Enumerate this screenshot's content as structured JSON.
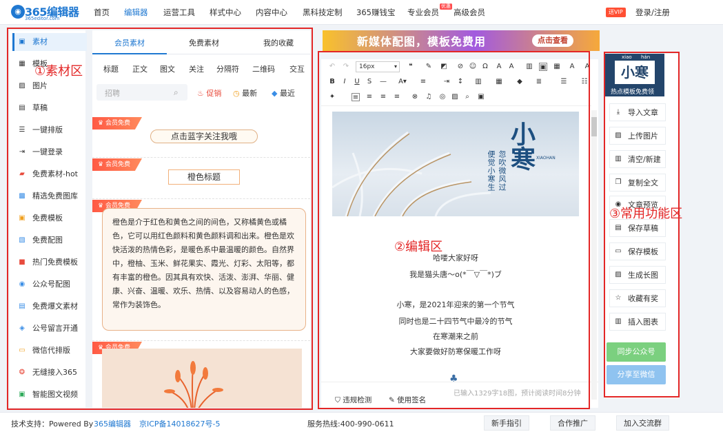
{
  "nav": {
    "logo_text": "365编辑器",
    "logo_sub": "365editor.com",
    "items": [
      "首页",
      "编辑器",
      "运营工具",
      "样式中心",
      "内容中心",
      "黑科技定制",
      "365赚钱宝",
      "专业会员",
      "高级会员"
    ],
    "new_badge": "优惠",
    "vip_badge": "送VIP",
    "login": "登录/注册"
  },
  "left_nav": {
    "items": [
      {
        "label": "素材",
        "icon": "material-icon"
      },
      {
        "label": "模板",
        "icon": "template-icon"
      },
      {
        "label": "图片",
        "icon": "image-icon"
      },
      {
        "label": "草稿",
        "icon": "draft-icon"
      },
      {
        "label": "一键排版",
        "icon": "list-icon"
      },
      {
        "label": "一键登录",
        "icon": "login-icon"
      },
      {
        "label": "免费素材-hot",
        "icon": "free-material-icon"
      },
      {
        "label": "精选免费图库",
        "icon": "gallery-icon"
      },
      {
        "label": "免费模板",
        "icon": "free-template-icon"
      },
      {
        "label": "免费配图",
        "icon": "free-image-icon"
      },
      {
        "label": "热门免费模板",
        "icon": "hot-template-icon"
      },
      {
        "label": "公众号配图",
        "icon": "wechat-image-icon"
      },
      {
        "label": "免费爆文素材",
        "icon": "article-icon"
      },
      {
        "label": "公号留言开通",
        "icon": "comment-icon"
      },
      {
        "label": "微信代排版",
        "icon": "wechat-layout-icon"
      },
      {
        "label": "无缝接入365",
        "icon": "connect-icon"
      },
      {
        "label": "智能图文视频",
        "icon": "video-icon"
      }
    ]
  },
  "material": {
    "tabs": [
      "会员素材",
      "免费素材",
      "我的收藏"
    ],
    "categories": [
      "标题",
      "正文",
      "图文",
      "关注",
      "分隔符",
      "二维码",
      "交互"
    ],
    "search_placeholder": "招聘",
    "filters": [
      "促销",
      "最新",
      "最近"
    ],
    "tag_label": "会员免费",
    "preview1": "点击蓝字关注我哦",
    "preview2": "橙色标题",
    "preview3": "橙色是介于红色和黄色之间的间色，又称橘黄色或橘色，它可以用红色颜料和黄色颜料调和出来。橙色是欢快活泼的热情色彩，是暖色系中最温暖的颜色。自然界中，橙柚、玉米、鲜花果实、霞光、灯彩、太阳等，都有丰富的橙色。因其具有欢快、活泼、澎湃、华丽、健康、兴奋、温暖、欢乐、热情、以及容易动人的色感，常作为装饰色。"
  },
  "banner": {
    "text": "新媒体配图，模板免费用",
    "button": "点击查看"
  },
  "editor": {
    "font_size": "16px",
    "image_title": "小寒",
    "image_pinyin": "XIAOHAN",
    "image_poem1": "忽吹微风过",
    "image_poem2": "便觉小寒生",
    "lines": [
      "哈喽大家好呀",
      "我是猫头唐～o(*￣▽￣*)ブ",
      "",
      "小寒，是2021年迎来的第一个节气",
      "同时也是二十四节气中最冷的节气",
      "在寒潮来之前",
      "大家要做好防寒保暖工作呀"
    ],
    "check_label": "违规检测",
    "sign_label": "使用签名",
    "count_text": "已输入1329字18图，预计阅读时间8分钟"
  },
  "right": {
    "head_pinyin1": "xiao",
    "head_pinyin2": "hán",
    "head_title": "小寒",
    "head_sub": "热点模板免费领",
    "actions": [
      {
        "label": "导入文章",
        "icon": "import-icon"
      },
      {
        "label": "上传图片",
        "icon": "upload-image-icon"
      },
      {
        "label": "清空/新建",
        "icon": "trash-icon"
      },
      {
        "label": "复制全文",
        "icon": "copy-icon"
      },
      {
        "label": "文章预览",
        "icon": "preview-icon"
      },
      {
        "label": "保存草稿",
        "icon": "save-draft-icon"
      },
      {
        "label": "保存模板",
        "icon": "save-template-icon"
      },
      {
        "label": "生成长图",
        "icon": "long-image-icon"
      },
      {
        "label": "收藏有奖",
        "icon": "star-icon"
      },
      {
        "label": "插入图表",
        "icon": "chart-icon"
      }
    ],
    "sync": "同步公众号",
    "share": "分享至微信"
  },
  "annotations": {
    "a1": "①素材区",
    "a2": "②编辑区",
    "a3": "③常用功能区"
  },
  "footer": {
    "support": "技术支持：Powered By",
    "brand": "365编辑器",
    "icp": "京ICP备14018627号-5",
    "hotline": "服务热线:400-990-0611",
    "buttons": [
      "新手指引",
      "合作推广",
      "加入交流群"
    ]
  },
  "colors": {
    "accent": "#1f78d1",
    "annotation": "#e32626",
    "tag": "#ff5a45",
    "sync": "#7bd07f",
    "share": "#8fc3f0"
  }
}
